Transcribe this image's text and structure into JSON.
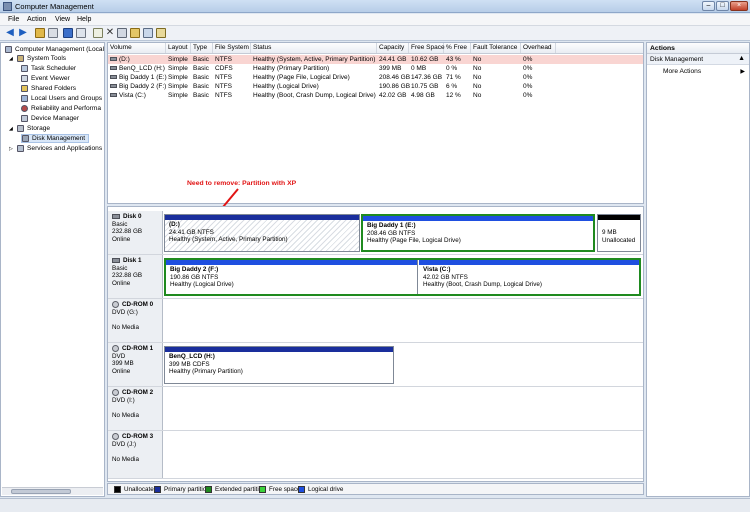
{
  "window": {
    "title": "Computer Management"
  },
  "menu": [
    "File",
    "Action",
    "View",
    "Help"
  ],
  "tree": [
    {
      "label": "Computer Management (Local",
      "level": 0
    },
    {
      "label": "System Tools",
      "level": 1
    },
    {
      "label": "Task Scheduler",
      "level": 2
    },
    {
      "label": "Event Viewer",
      "level": 2
    },
    {
      "label": "Shared Folders",
      "level": 2
    },
    {
      "label": "Local Users and Groups",
      "level": 2
    },
    {
      "label": "Reliability and Performa",
      "level": 2
    },
    {
      "label": "Device Manager",
      "level": 2
    },
    {
      "label": "Storage",
      "level": 1
    },
    {
      "label": "Disk Management",
      "level": 2
    },
    {
      "label": "Services and Applications",
      "level": 1
    }
  ],
  "volume_table": {
    "headers": [
      "Volume",
      "Layout",
      "Type",
      "File System",
      "Status",
      "Capacity",
      "Free Space",
      "% Free",
      "Fault Tolerance",
      "Overhead"
    ],
    "rows": [
      [
        "(D:)",
        "Simple",
        "Basic",
        "NTFS",
        "Healthy (System, Active, Primary Partition)",
        "24.41 GB",
        "10.62 GB",
        "43 %",
        "No",
        "0%"
      ],
      [
        "BenQ_LCD (H:)",
        "Simple",
        "Basic",
        "CDFS",
        "Healthy (Primary Partition)",
        "399 MB",
        "0 MB",
        "0 %",
        "No",
        "0%"
      ],
      [
        "Big Daddy 1 (E:)",
        "Simple",
        "Basic",
        "NTFS",
        "Healthy (Page File, Logical Drive)",
        "208.46 GB",
        "147.36 GB",
        "71 %",
        "No",
        "0%"
      ],
      [
        "Big Daddy 2 (F:)",
        "Simple",
        "Basic",
        "NTFS",
        "Healthy (Logical Drive)",
        "190.86 GB",
        "10.75 GB",
        "6 %",
        "No",
        "0%"
      ],
      [
        "Vista (C:)",
        "Simple",
        "Basic",
        "NTFS",
        "Healthy (Boot, Crash Dump, Logical Drive)",
        "42.02 GB",
        "4.98 GB",
        "12 %",
        "No",
        "0%"
      ]
    ]
  },
  "annotation": "Need to remove: Partition with XP",
  "disks": {
    "disk0": {
      "name": "Disk 0",
      "type": "Basic",
      "size": "232.88 GB",
      "state": "Online",
      "p1": {
        "name": "(D:)",
        "size": "24.41 GB NTFS",
        "status": "Healthy (System, Active, Primary Partition)"
      },
      "p2": {
        "name": "Big Daddy 1  (E:)",
        "size": "208.46 GB NTFS",
        "status": "Healthy (Page File, Logical Drive)"
      },
      "p3": {
        "size": "9 MB",
        "status": "Unallocated"
      }
    },
    "disk1": {
      "name": "Disk 1",
      "type": "Basic",
      "size": "232.88 GB",
      "state": "Online",
      "p1": {
        "name": "Big Daddy 2  (F:)",
        "size": "190.86 GB NTFS",
        "status": "Healthy (Logical Drive)"
      },
      "p2": {
        "name": "Vista  (C:)",
        "size": "42.02 GB NTFS",
        "status": "Healthy (Boot, Crash Dump, Logical Drive)"
      }
    },
    "cd0": {
      "name": "CD-ROM 0",
      "type": "DVD (G:)",
      "state": "No Media"
    },
    "cd1": {
      "name": "CD-ROM 1",
      "type": "DVD",
      "size": "399 MB",
      "state": "Online",
      "p1": {
        "name": "BenQ_LCD  (H:)",
        "size": "399 MB CDFS",
        "status": "Healthy (Primary Partition)"
      }
    },
    "cd2": {
      "name": "CD-ROM 2",
      "type": "DVD (I:)",
      "state": "No Media"
    },
    "cd3": {
      "name": "CD-ROM 3",
      "type": "DVD (J:)",
      "state": "No Media"
    }
  },
  "legend": [
    {
      "label": "Unallocated",
      "color": "#000000"
    },
    {
      "label": "Primary partition",
      "color": "#1a2e9c"
    },
    {
      "label": "Extended partition",
      "color": "#1f8a1f"
    },
    {
      "label": "Free space",
      "color": "#3cd23c"
    },
    {
      "label": "Logical drive",
      "color": "#1f4fe0"
    }
  ],
  "actions": {
    "title": "Actions",
    "section": "Disk Management",
    "more": "More Actions"
  },
  "colors": {
    "primary": "#1a2e9c",
    "logical": "#1f4fe0",
    "extended": "#1f8a1f",
    "unallocated": "#000000",
    "annotation": "#e11414"
  }
}
